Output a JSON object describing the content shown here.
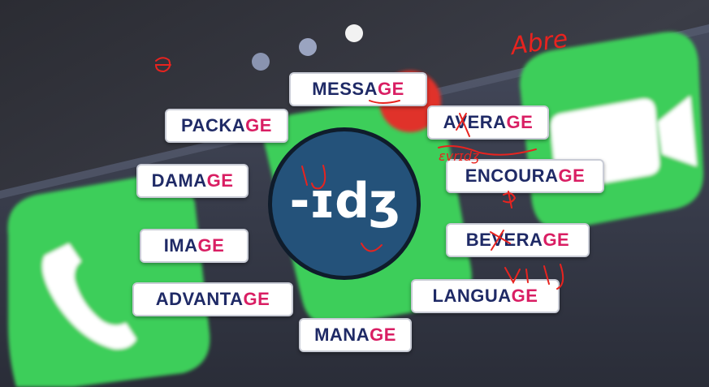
{
  "logo": {
    "text": "-ɪdʒ",
    "color": "#24527a"
  },
  "accent_color": "#d91e63",
  "text_color": "#1f2a66",
  "words": [
    {
      "id": "message",
      "stem": "MESSA",
      "end": "GE"
    },
    {
      "id": "package",
      "stem": "PACKA",
      "end": "GE"
    },
    {
      "id": "average",
      "stem": "AVERA",
      "end": "GE"
    },
    {
      "id": "damage",
      "stem": "DAMA",
      "end": "GE"
    },
    {
      "id": "encourage",
      "stem": "ENCOURA",
      "end": "GE"
    },
    {
      "id": "image",
      "stem": "IMA",
      "end": "GE"
    },
    {
      "id": "beverage",
      "stem": "BEVERA",
      "end": "GE"
    },
    {
      "id": "advantage",
      "stem": "ADVANTA",
      "end": "GE"
    },
    {
      "id": "language",
      "stem": "LANGUA",
      "end": "GE"
    },
    {
      "id": "manage",
      "stem": "MANA",
      "end": "GE"
    }
  ],
  "handwriting": {
    "abre": "Abre",
    "iyj": "IJ",
    "vrij": "VrIJ"
  },
  "background_icons": [
    "phone-icon",
    "messages-icon",
    "facetime-icon"
  ]
}
